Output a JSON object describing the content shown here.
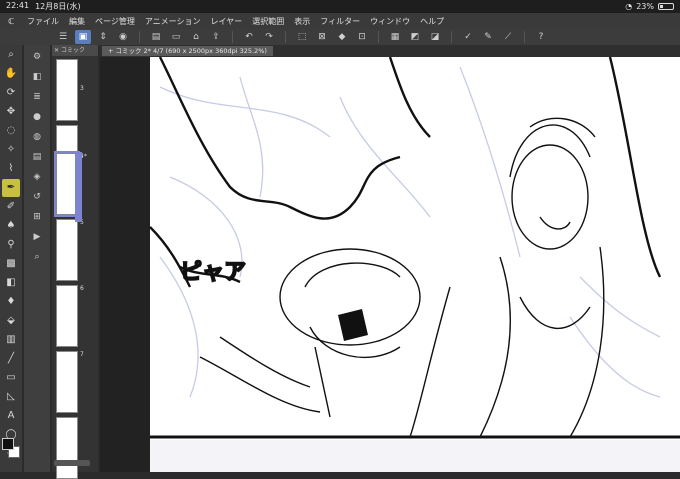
{
  "status": {
    "time": "22:41",
    "date": "12月8日(水)",
    "battery": "23%",
    "battery_level": 0.23
  },
  "menu": {
    "items": [
      "ファイル",
      "編集",
      "ページ管理",
      "アニメーション",
      "レイヤー",
      "選択範囲",
      "表示",
      "フィルター",
      "ウィンドウ",
      "ヘルプ"
    ]
  },
  "pages_panel": {
    "tab_label": "コミック",
    "page_numbers": [
      "3",
      "4*",
      "5",
      "6",
      "7"
    ]
  },
  "canvas": {
    "tab_label": "コミック 2* 4/7 (690 x 2500px 360dpi 325.2%)",
    "sfx_text": "ピャア"
  },
  "colors": {
    "accent": "#5a7dbb",
    "selected_tool": "#c8c040",
    "page_select": "#7d85d0"
  }
}
